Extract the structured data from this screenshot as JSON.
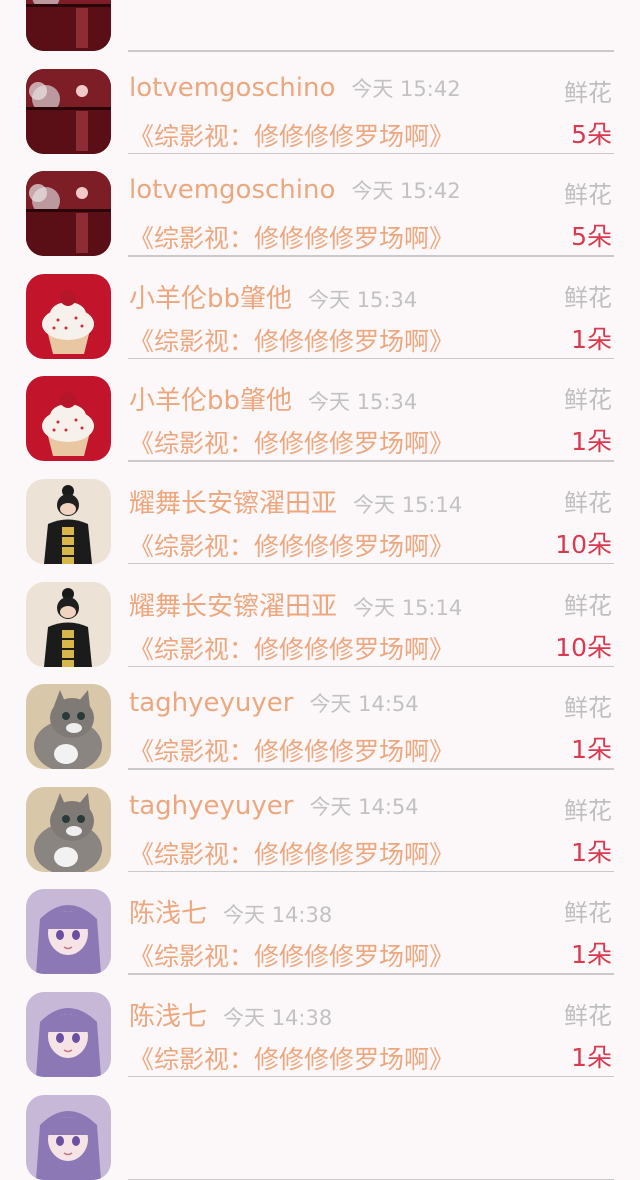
{
  "list": {
    "items": [
      {
        "avatar": "avatar-sunset-lake",
        "name": "",
        "time": "",
        "gift": "",
        "book": "",
        "count": ""
      },
      {
        "avatar": "avatar-sunset-lake",
        "name": "lotvemgoschino",
        "time": "今天 15:42",
        "gift": "鲜花",
        "book": "《综影视：修修修修罗场啊》",
        "count": "5朵"
      },
      {
        "avatar": "avatar-sunset-lake",
        "name": "lotvemgoschino",
        "time": "今天 15:42",
        "gift": "鲜花",
        "book": "《综影视：修修修修罗场啊》",
        "count": "5朵"
      },
      {
        "avatar": "avatar-cupcake",
        "name": "小羊伦bb肇他",
        "time": "今天 15:34",
        "gift": "鲜花",
        "book": "《综影视：修修修修罗场啊》",
        "count": "1朵"
      },
      {
        "avatar": "avatar-cupcake",
        "name": "小羊伦bb肇他",
        "time": "今天 15:34",
        "gift": "鲜花",
        "book": "《综影视：修修修修罗场啊》",
        "count": "1朵"
      },
      {
        "avatar": "avatar-girl-photo",
        "name": "耀舞长安镲濯田亚",
        "time": "今天 15:14",
        "gift": "鲜花",
        "book": "《综影视：修修修修罗场啊》",
        "count": "10朵"
      },
      {
        "avatar": "avatar-girl-photo",
        "name": "耀舞长安镲濯田亚",
        "time": "今天 15:14",
        "gift": "鲜花",
        "book": "《综影视：修修修修罗场啊》",
        "count": "10朵"
      },
      {
        "avatar": "avatar-kitten",
        "name": "taghyeyuyer",
        "time": "今天 14:54",
        "gift": "鲜花",
        "book": "《综影视：修修修修罗场啊》",
        "count": "1朵"
      },
      {
        "avatar": "avatar-kitten",
        "name": "taghyeyuyer",
        "time": "今天 14:54",
        "gift": "鲜花",
        "book": "《综影视：修修修修罗场啊》",
        "count": "1朵"
      },
      {
        "avatar": "avatar-anime-girl",
        "name": "陈浅七",
        "time": "今天 14:38",
        "gift": "鲜花",
        "book": "《综影视：修修修修罗场啊》",
        "count": "1朵"
      },
      {
        "avatar": "avatar-anime-girl",
        "name": "陈浅七",
        "time": "今天 14:38",
        "gift": "鲜花",
        "book": "《综影视：修修修修罗场啊》",
        "count": "1朵"
      },
      {
        "avatar": "avatar-anime-girl",
        "name": "",
        "time": "",
        "gift": "",
        "book": "",
        "count": ""
      }
    ]
  },
  "colors": {
    "background": "#fcf8f9",
    "name_text": "#eda77f",
    "time_text": "#c2c2c2",
    "gift_text": "#bfbfbf",
    "count_text": "#d93a4f",
    "divider": "#c9c9c9"
  }
}
